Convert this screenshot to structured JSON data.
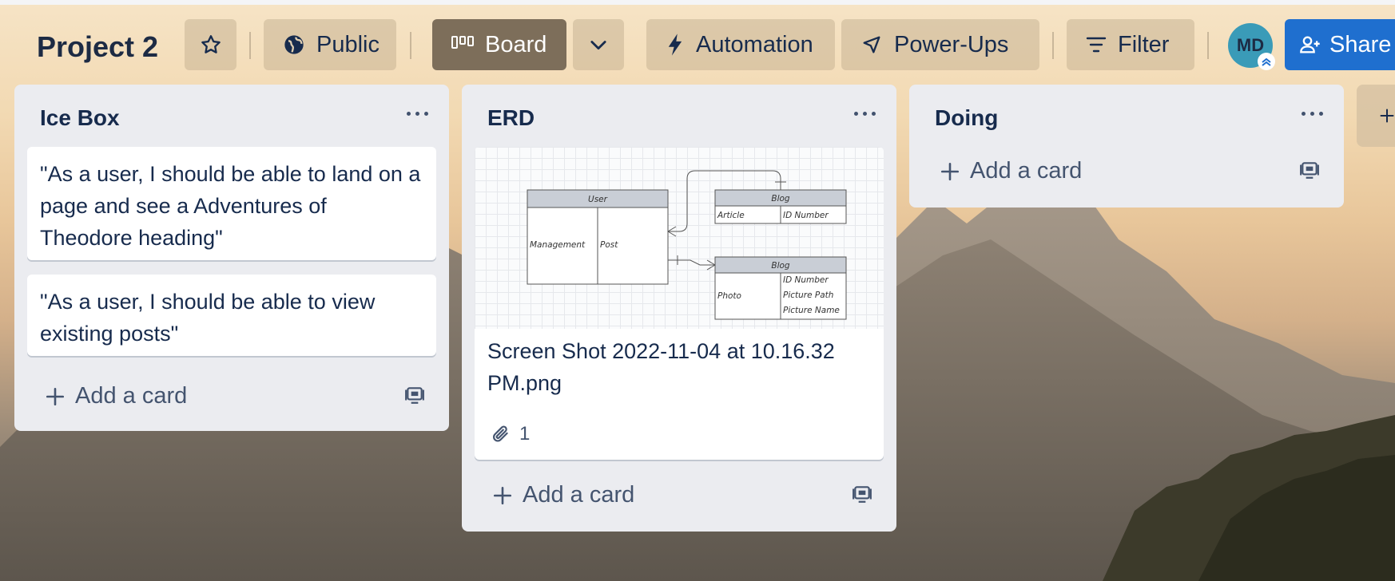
{
  "board": {
    "title": "Project 2",
    "visibility_label": "Public",
    "view_label": "Board",
    "automation_label": "Automation",
    "powerups_label": "Power-Ups",
    "filter_label": "Filter",
    "member_initials": "MD",
    "share_label": "Share"
  },
  "colors": {
    "share_button": "#1f6fcf",
    "board_view_button": "#7d6e5a",
    "avatar": "#3a9bb8",
    "list_bg": "#ebecf0"
  },
  "lists": [
    {
      "title": "Ice Box",
      "cards": [
        "\"As a user, I should be able to land on a page and see a Adventures of Theodore heading\"",
        "\"As a user, I should be able to view existing posts\""
      ],
      "add_card_label": "Add a card"
    },
    {
      "title": "ERD",
      "cards": [
        {
          "title": "Screen Shot 2022-11-04 at 10.16.32 PM.png",
          "attachments": "1",
          "thumbnail": {
            "user_table": {
              "header": "User",
              "col1": "Management",
              "col2": "Post"
            },
            "blog_table_1": {
              "header": "Blog",
              "col1": "Article",
              "col2": "ID Number"
            },
            "blog_table_2": {
              "header": "Blog",
              "col1": "Photo",
              "fields": [
                "ID Number",
                "Picture Path",
                "Picture Name"
              ]
            }
          }
        }
      ],
      "add_card_label": "Add a card"
    },
    {
      "title": "Doing",
      "cards": [],
      "add_card_label": "Add a card"
    }
  ],
  "icons": [
    "star-icon",
    "globe-icon",
    "board-icon",
    "chevron-down-icon",
    "lightning-icon",
    "rocket-icon",
    "filter-icon",
    "add-member-icon",
    "more-icon",
    "plus-icon",
    "template-icon",
    "attachment-icon"
  ]
}
